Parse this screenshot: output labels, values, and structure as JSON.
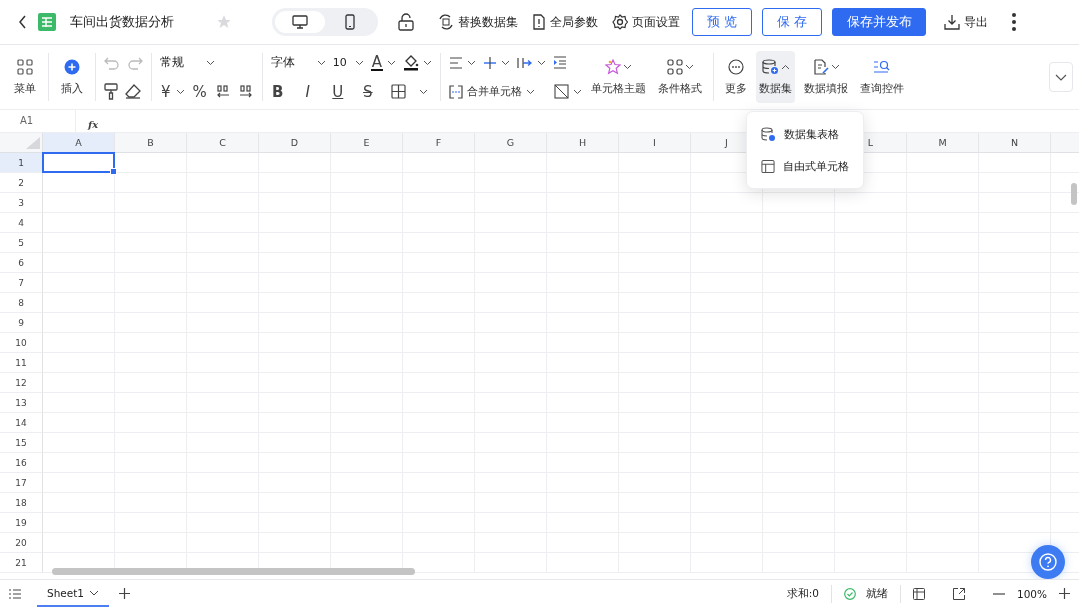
{
  "header": {
    "title": "车间出货数据分析",
    "starred": false,
    "view_modes": [
      {
        "kind": "desktop",
        "selected": true
      },
      {
        "kind": "mobile",
        "selected": false
      }
    ],
    "actions": [
      {
        "kind": "swap",
        "label": "替换数据集"
      },
      {
        "kind": "params",
        "label": "全局参数"
      },
      {
        "kind": "settings",
        "label": "页面设置"
      }
    ],
    "buttons": [
      {
        "kind": "outline",
        "label": "预 览"
      },
      {
        "kind": "outline",
        "label": "保 存"
      },
      {
        "kind": "primary",
        "label": "保存并发布"
      }
    ],
    "export": "导出"
  },
  "toolbar": {
    "menu": "菜单",
    "insert": "插入",
    "number_format": "常规",
    "number_symbols": [
      "¥",
      "%"
    ],
    "font": "字体",
    "font_size": "10",
    "font_color": "A",
    "text_styles": [
      "B",
      "I",
      "U",
      "S"
    ],
    "merge": "合并单元格",
    "tools": [
      {
        "kind": "theme",
        "label": "单元格主题",
        "selected": false
      },
      {
        "kind": "cond",
        "label": "条件格式",
        "selected": false
      },
      {
        "kind": "more",
        "label": "更多",
        "selected": false
      },
      {
        "kind": "dataset",
        "label": "数据集",
        "selected": true
      },
      {
        "kind": "fill",
        "label": "数据填报",
        "selected": false
      },
      {
        "kind": "query",
        "label": "查询控件",
        "selected": false
      }
    ]
  },
  "formula_bar": {
    "cell_ref": "A1",
    "fx": "fx"
  },
  "sheet": {
    "columns": [
      {
        "label": "A",
        "selected": true
      },
      {
        "label": "B",
        "selected": false
      },
      {
        "label": "C",
        "selected": false
      },
      {
        "label": "D",
        "selected": false
      },
      {
        "label": "E",
        "selected": false
      },
      {
        "label": "F",
        "selected": false
      },
      {
        "label": "G",
        "selected": false
      },
      {
        "label": "H",
        "selected": false
      },
      {
        "label": "I",
        "selected": false
      },
      {
        "label": "J",
        "selected": false
      },
      {},
      {
        "label": "L",
        "selected": false
      },
      {
        "label": "M",
        "selected": false
      },
      {
        "label": "N",
        "selected": false
      }
    ],
    "rows": [
      {
        "label": "1",
        "selected": true
      },
      {
        "label": "2",
        "selected": false
      },
      {
        "label": "3",
        "selected": false
      },
      {
        "label": "4",
        "selected": false
      },
      {
        "label": "5",
        "selected": false
      },
      {
        "label": "6",
        "selected": false
      },
      {
        "label": "7",
        "selected": false
      },
      {
        "label": "8",
        "selected": false
      },
      {
        "label": "9",
        "selected": false
      },
      {
        "label": "10",
        "selected": false
      },
      {
        "label": "11",
        "selected": false
      },
      {
        "label": "12",
        "selected": false
      },
      {
        "label": "13",
        "selected": false
      },
      {
        "label": "14",
        "selected": false
      },
      {
        "label": "15",
        "selected": false
      },
      {
        "label": "16",
        "selected": false
      },
      {
        "label": "17",
        "selected": false
      },
      {
        "label": "18",
        "selected": false
      },
      {
        "label": "19",
        "selected": false
      },
      {
        "label": "20",
        "selected": false
      },
      {
        "label": "21",
        "selected": false
      }
    ]
  },
  "dataset_menu": {
    "items": [
      {
        "kind": "table",
        "label": "数据集表格"
      },
      {
        "kind": "free",
        "label": "自由式单元格"
      }
    ]
  },
  "status_bar": {
    "sheets": [
      {
        "label": "Sheet1",
        "selected": true
      }
    ],
    "sum": "求和:0",
    "status": "就绪",
    "zoom": "100%"
  }
}
